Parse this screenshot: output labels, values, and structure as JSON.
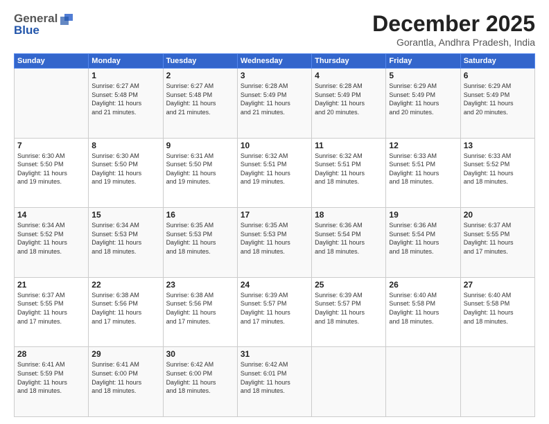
{
  "header": {
    "logo": {
      "line1": "General",
      "line2": "Blue"
    },
    "title": "December 2025",
    "subtitle": "Gorantla, Andhra Pradesh, India"
  },
  "calendar": {
    "days_of_week": [
      "Sunday",
      "Monday",
      "Tuesday",
      "Wednesday",
      "Thursday",
      "Friday",
      "Saturday"
    ],
    "weeks": [
      [
        {
          "date": "",
          "info": ""
        },
        {
          "date": "1",
          "info": "Sunrise: 6:27 AM\nSunset: 5:48 PM\nDaylight: 11 hours\nand 21 minutes."
        },
        {
          "date": "2",
          "info": "Sunrise: 6:27 AM\nSunset: 5:48 PM\nDaylight: 11 hours\nand 21 minutes."
        },
        {
          "date": "3",
          "info": "Sunrise: 6:28 AM\nSunset: 5:49 PM\nDaylight: 11 hours\nand 21 minutes."
        },
        {
          "date": "4",
          "info": "Sunrise: 6:28 AM\nSunset: 5:49 PM\nDaylight: 11 hours\nand 20 minutes."
        },
        {
          "date": "5",
          "info": "Sunrise: 6:29 AM\nSunset: 5:49 PM\nDaylight: 11 hours\nand 20 minutes."
        },
        {
          "date": "6",
          "info": "Sunrise: 6:29 AM\nSunset: 5:49 PM\nDaylight: 11 hours\nand 20 minutes."
        }
      ],
      [
        {
          "date": "7",
          "info": "Sunrise: 6:30 AM\nSunset: 5:50 PM\nDaylight: 11 hours\nand 19 minutes."
        },
        {
          "date": "8",
          "info": "Sunrise: 6:30 AM\nSunset: 5:50 PM\nDaylight: 11 hours\nand 19 minutes."
        },
        {
          "date": "9",
          "info": "Sunrise: 6:31 AM\nSunset: 5:50 PM\nDaylight: 11 hours\nand 19 minutes."
        },
        {
          "date": "10",
          "info": "Sunrise: 6:32 AM\nSunset: 5:51 PM\nDaylight: 11 hours\nand 19 minutes."
        },
        {
          "date": "11",
          "info": "Sunrise: 6:32 AM\nSunset: 5:51 PM\nDaylight: 11 hours\nand 18 minutes."
        },
        {
          "date": "12",
          "info": "Sunrise: 6:33 AM\nSunset: 5:51 PM\nDaylight: 11 hours\nand 18 minutes."
        },
        {
          "date": "13",
          "info": "Sunrise: 6:33 AM\nSunset: 5:52 PM\nDaylight: 11 hours\nand 18 minutes."
        }
      ],
      [
        {
          "date": "14",
          "info": "Sunrise: 6:34 AM\nSunset: 5:52 PM\nDaylight: 11 hours\nand 18 minutes."
        },
        {
          "date": "15",
          "info": "Sunrise: 6:34 AM\nSunset: 5:53 PM\nDaylight: 11 hours\nand 18 minutes."
        },
        {
          "date": "16",
          "info": "Sunrise: 6:35 AM\nSunset: 5:53 PM\nDaylight: 11 hours\nand 18 minutes."
        },
        {
          "date": "17",
          "info": "Sunrise: 6:35 AM\nSunset: 5:53 PM\nDaylight: 11 hours\nand 18 minutes."
        },
        {
          "date": "18",
          "info": "Sunrise: 6:36 AM\nSunset: 5:54 PM\nDaylight: 11 hours\nand 18 minutes."
        },
        {
          "date": "19",
          "info": "Sunrise: 6:36 AM\nSunset: 5:54 PM\nDaylight: 11 hours\nand 18 minutes."
        },
        {
          "date": "20",
          "info": "Sunrise: 6:37 AM\nSunset: 5:55 PM\nDaylight: 11 hours\nand 17 minutes."
        }
      ],
      [
        {
          "date": "21",
          "info": "Sunrise: 6:37 AM\nSunset: 5:55 PM\nDaylight: 11 hours\nand 17 minutes."
        },
        {
          "date": "22",
          "info": "Sunrise: 6:38 AM\nSunset: 5:56 PM\nDaylight: 11 hours\nand 17 minutes."
        },
        {
          "date": "23",
          "info": "Sunrise: 6:38 AM\nSunset: 5:56 PM\nDaylight: 11 hours\nand 17 minutes."
        },
        {
          "date": "24",
          "info": "Sunrise: 6:39 AM\nSunset: 5:57 PM\nDaylight: 11 hours\nand 17 minutes."
        },
        {
          "date": "25",
          "info": "Sunrise: 6:39 AM\nSunset: 5:57 PM\nDaylight: 11 hours\nand 18 minutes."
        },
        {
          "date": "26",
          "info": "Sunrise: 6:40 AM\nSunset: 5:58 PM\nDaylight: 11 hours\nand 18 minutes."
        },
        {
          "date": "27",
          "info": "Sunrise: 6:40 AM\nSunset: 5:58 PM\nDaylight: 11 hours\nand 18 minutes."
        }
      ],
      [
        {
          "date": "28",
          "info": "Sunrise: 6:41 AM\nSunset: 5:59 PM\nDaylight: 11 hours\nand 18 minutes."
        },
        {
          "date": "29",
          "info": "Sunrise: 6:41 AM\nSunset: 6:00 PM\nDaylight: 11 hours\nand 18 minutes."
        },
        {
          "date": "30",
          "info": "Sunrise: 6:42 AM\nSunset: 6:00 PM\nDaylight: 11 hours\nand 18 minutes."
        },
        {
          "date": "31",
          "info": "Sunrise: 6:42 AM\nSunset: 6:01 PM\nDaylight: 11 hours\nand 18 minutes."
        },
        {
          "date": "",
          "info": ""
        },
        {
          "date": "",
          "info": ""
        },
        {
          "date": "",
          "info": ""
        }
      ]
    ]
  }
}
